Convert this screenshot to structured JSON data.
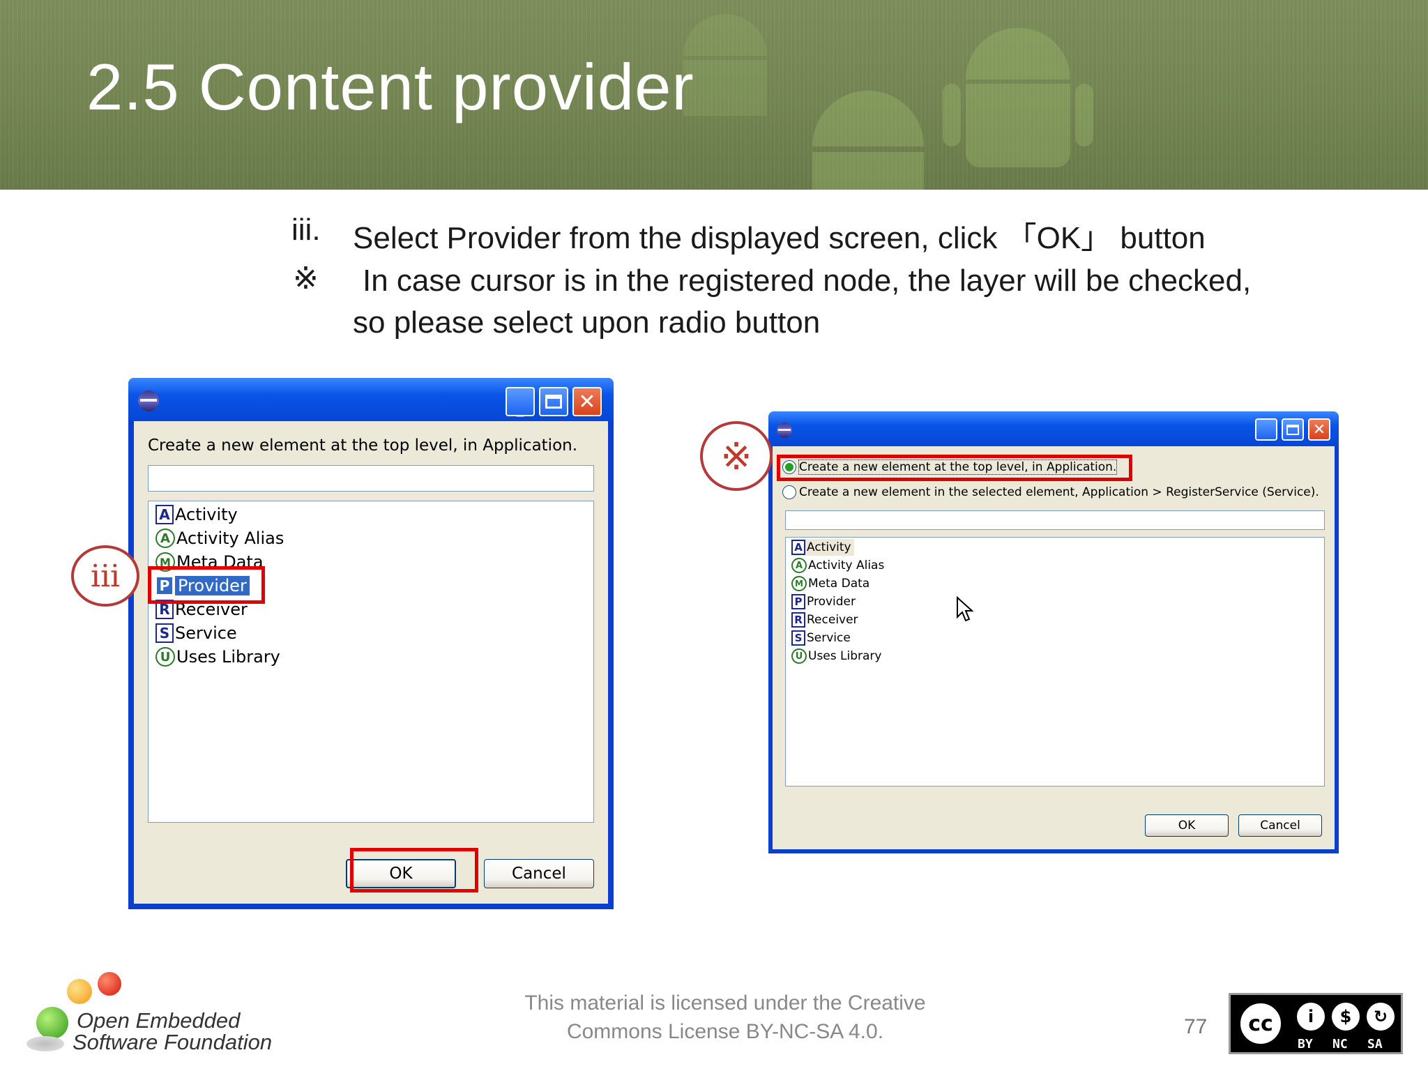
{
  "slide": {
    "title": "2.5 Content provider",
    "bullets": [
      {
        "marker": "iii.",
        "text": "Select Provider from the displayed screen, click 「OK」 button"
      },
      {
        "marker": "※",
        "text": "In case cursor is in the registered node, the layer will be checked,",
        "continuation": "so please select upon radio button"
      }
    ],
    "page_number": "77",
    "license_text_line1": "This material is licensed under the Creative",
    "license_text_line2": "Commons License BY-NC-SA 4.0.",
    "logo_line1": "Open Embedded",
    "logo_line2": "Software Foundation"
  },
  "dialog_left": {
    "prompt": "Create a new element at the top level, in Application.",
    "filter_value": "",
    "items": [
      {
        "icon": "A",
        "shape": "square",
        "label": "Activity"
      },
      {
        "icon": "A",
        "shape": "circle",
        "label": "Activity Alias"
      },
      {
        "icon": "M",
        "shape": "circle",
        "label": "Meta Data"
      },
      {
        "icon": "P",
        "shape": "square",
        "label": "Provider",
        "selected": true
      },
      {
        "icon": "R",
        "shape": "square",
        "label": "Receiver"
      },
      {
        "icon": "S",
        "shape": "square",
        "label": "Service"
      },
      {
        "icon": "U",
        "shape": "circle",
        "label": "Uses Library"
      }
    ],
    "ok_label": "OK",
    "cancel_label": "Cancel",
    "callout": "iii"
  },
  "dialog_right": {
    "radio_top": "Create a new element at the top level, in Application.",
    "radio_selected": "Create a new element in the selected element, Application > RegisterService (Service).",
    "filter_value": "",
    "items": [
      {
        "icon": "A",
        "shape": "square",
        "label": "Activity"
      },
      {
        "icon": "A",
        "shape": "circle",
        "label": "Activity Alias"
      },
      {
        "icon": "M",
        "shape": "circle",
        "label": "Meta Data"
      },
      {
        "icon": "P",
        "shape": "square",
        "label": "Provider"
      },
      {
        "icon": "R",
        "shape": "square",
        "label": "Receiver"
      },
      {
        "icon": "S",
        "shape": "square",
        "label": "Service"
      },
      {
        "icon": "U",
        "shape": "circle",
        "label": "Uses Library"
      }
    ],
    "ok_label": "OK",
    "cancel_label": "Cancel",
    "callout": "※"
  },
  "cc_badge": {
    "by": "BY",
    "nc": "NC",
    "sa": "SA"
  },
  "colors": {
    "accent_red": "#e00000",
    "xp_blue": "#0a54e6",
    "banner_green": "#748653",
    "selection_blue": "#316ac5"
  }
}
